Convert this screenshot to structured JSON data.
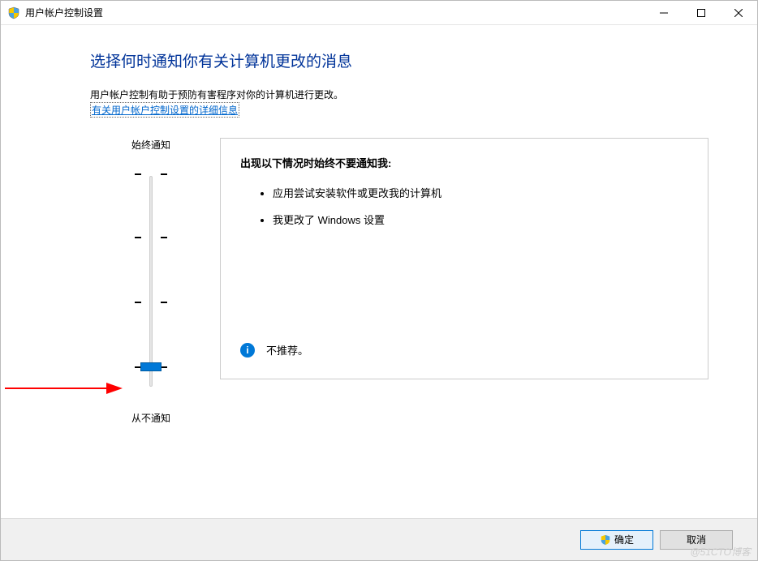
{
  "window": {
    "title": "用户帐户控制设置"
  },
  "content": {
    "heading": "选择何时通知你有关计算机更改的消息",
    "description": "用户帐户控制有助于预防有害程序对你的计算机进行更改。",
    "link_text": "有关用户帐户控制设置的详细信息"
  },
  "slider": {
    "top_label": "始终通知",
    "bottom_label": "从不通知",
    "level": 0
  },
  "panel": {
    "heading": "出现以下情况时始终不要通知我:",
    "items": [
      "应用尝试安装软件或更改我的计算机",
      "我更改了 Windows 设置"
    ],
    "footer_text": "不推荐。"
  },
  "buttons": {
    "ok": "确定",
    "cancel": "取消"
  },
  "watermark": "@51CTO博客"
}
